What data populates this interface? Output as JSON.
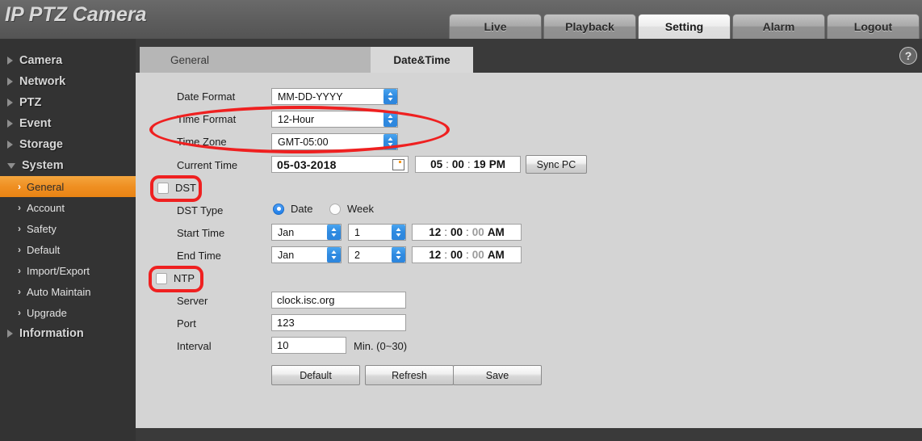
{
  "header": {
    "title": "IP PTZ Camera",
    "nav_tabs": [
      {
        "label": "Live",
        "active": false
      },
      {
        "label": "Playback",
        "active": false
      },
      {
        "label": "Setting",
        "active": true
      },
      {
        "label": "Alarm",
        "active": false
      },
      {
        "label": "Logout",
        "active": false
      }
    ]
  },
  "help": {
    "icon": "question-mark-icon",
    "glyph": "?"
  },
  "sidebar": {
    "items": [
      {
        "label": "Camera",
        "type": "group",
        "expanded": false
      },
      {
        "label": "Network",
        "type": "group",
        "expanded": false
      },
      {
        "label": "PTZ",
        "type": "group",
        "expanded": false
      },
      {
        "label": "Event",
        "type": "group",
        "expanded": false
      },
      {
        "label": "Storage",
        "type": "group",
        "expanded": false
      },
      {
        "label": "System",
        "type": "group",
        "expanded": true
      },
      {
        "label": "General",
        "type": "sub",
        "selected": true
      },
      {
        "label": "Account",
        "type": "sub",
        "selected": false
      },
      {
        "label": "Safety",
        "type": "sub",
        "selected": false
      },
      {
        "label": "Default",
        "type": "sub",
        "selected": false
      },
      {
        "label": "Import/Export",
        "type": "sub",
        "selected": false
      },
      {
        "label": "Auto Maintain",
        "type": "sub",
        "selected": false
      },
      {
        "label": "Upgrade",
        "type": "sub",
        "selected": false
      },
      {
        "label": "Information",
        "type": "group",
        "expanded": false
      }
    ],
    "chevron_glyph": "›"
  },
  "content_tabs": [
    {
      "label": "General",
      "active": false
    },
    {
      "label": "Date&Time",
      "active": true
    }
  ],
  "form": {
    "date_format": {
      "label": "Date Format",
      "value": "MM-DD-YYYY"
    },
    "time_format": {
      "label": "Time Format",
      "value": "12-Hour"
    },
    "time_zone": {
      "label": "Time Zone",
      "value": "GMT-05:00"
    },
    "current_time": {
      "label": "Current Time",
      "date_value": "05-03-2018",
      "hour": "05",
      "minute": "00",
      "second": "19",
      "meridiem": "PM",
      "sync_button": "Sync PC",
      "calendar_icon": "calendar-icon"
    },
    "dst": {
      "label": "DST",
      "checked": false
    },
    "dst_type": {
      "label": "DST Type",
      "options": [
        {
          "label": "Date",
          "selected": true
        },
        {
          "label": "Week",
          "selected": false
        }
      ]
    },
    "start_time": {
      "label": "Start Time",
      "month": "Jan",
      "day": "1",
      "hour": "12",
      "minute": "00",
      "second": "00",
      "meridiem": "AM"
    },
    "end_time": {
      "label": "End Time",
      "month": "Jan",
      "day": "2",
      "hour": "12",
      "minute": "00",
      "second": "00",
      "meridiem": "AM"
    },
    "ntp": {
      "label": "NTP",
      "checked": false
    },
    "server": {
      "label": "Server",
      "value": "clock.isc.org"
    },
    "port": {
      "label": "Port",
      "value": "123"
    },
    "interval": {
      "label": "Interval",
      "value": "10",
      "hint": "Min. (0~30)"
    },
    "buttons": [
      {
        "label": "Default"
      },
      {
        "label": "Refresh"
      },
      {
        "label": "Save"
      }
    ]
  },
  "colors": {
    "accent_orange": "#ef8f22",
    "annotation_red": "#ef2020",
    "stepper_blue": "#2f8ae0",
    "panel_gray": "#d4d4d4",
    "sidebar_dark": "#333333"
  },
  "separators": {
    "colon": ":"
  }
}
